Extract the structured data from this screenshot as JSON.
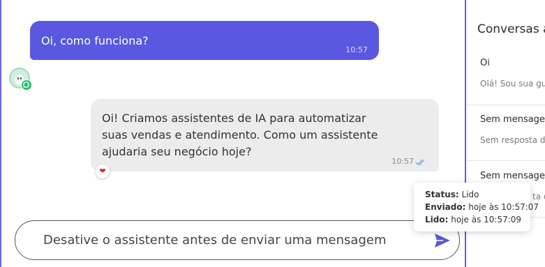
{
  "chat": {
    "outgoing": {
      "text": "Oi, como funciona?",
      "time": "10:57"
    },
    "incoming": {
      "text": "Oi! Criamos assistentes de IA para automatizar suas vendas e atendimento. Como um assistente ajudaria seu negócio hoje?",
      "time": "10:57",
      "reaction": "❤"
    },
    "avatar": {
      "icon": "bot-avatar-icon",
      "badge_icon": "whatsapp-icon"
    }
  },
  "tooltip": {
    "status_label": "Status:",
    "status_value": "Lido",
    "sent_label": "Enviado:",
    "sent_value": "hoje às 10:57:07",
    "read_label": "Lido:",
    "read_value": "hoje às 10:57:09"
  },
  "composer": {
    "placeholder": "Desative o assistente antes de enviar uma mensagem",
    "send_icon": "send-icon"
  },
  "sidebar": {
    "title": "Conversas ar",
    "items": [
      {
        "name": "Oi",
        "preview": "Olá! Sou sua gui"
      },
      {
        "name": "Sem mensager",
        "preview": "Sem resposta d"
      },
      {
        "name": "Sem mensager",
        "preview": "ta d"
      }
    ]
  },
  "colors": {
    "accent": "#5a57e0",
    "incoming_bg": "#ececec",
    "read_check": "#6aa7e8",
    "whatsapp": "#25c16b"
  }
}
